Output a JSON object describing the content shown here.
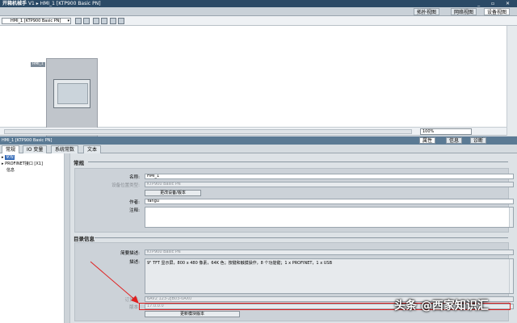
{
  "titlebar": {
    "project": "开箱机械手",
    "path": "V1 ▸ HMI_1 [KTP900 Basic PN]",
    "window_controls": "_ ▫ ✕"
  },
  "view_tabs": [
    "拓扑视图",
    "网络视图",
    "设备视图"
  ],
  "toolbar": {
    "device_select": "HMI_1 [KTP900 Basic PN]"
  },
  "canvas": {
    "device_label": "HMI_1"
  },
  "canvas_bar": {
    "zoom": "100%"
  },
  "inspector": {
    "title": "HMI_1 [KTP900 Basic PN]",
    "tabs": [
      "属性",
      "信息",
      "诊断"
    ],
    "subtabs": [
      "常规",
      "IO 变量",
      "系统常数",
      "文本"
    ]
  },
  "leftnav": {
    "items": [
      "常规",
      "PROFINET接口 [X1]",
      "信息"
    ]
  },
  "general": {
    "title": "常规",
    "name_label": "名称:",
    "name_value": "HMI_1",
    "devtype_label": "设备位置类型:",
    "devtype_value": "KTP900 Basic PN",
    "change_btn": "更改设备/版本",
    "author_label": "作者:",
    "author_value": "Yangu",
    "comment_label": "注释:",
    "comment_value": ""
  },
  "catalog": {
    "title": "目录信息",
    "short_label": "简要描述:",
    "short_value": "KTP900 Basic PN",
    "desc_label": "描述:",
    "desc_value": "9\" TFT 显示屏，800 x 480 像素，64K 色；按键和触摸操作，8 个功能键；1 x PROFINET，1 x USB",
    "order_label": "订货号:",
    "order_value": "6AV2 123-2JB03-0AX0",
    "version_label": "版本:",
    "version_value": "17.0.0.0",
    "update_btn": "更新模块版本"
  },
  "watermark": "头条 @西家知识汇",
  "colors": {
    "title_bar": "#2b4a66",
    "inspector_header": "#5b7a94",
    "highlight": "#e02020",
    "selection": "#2a63b4"
  }
}
